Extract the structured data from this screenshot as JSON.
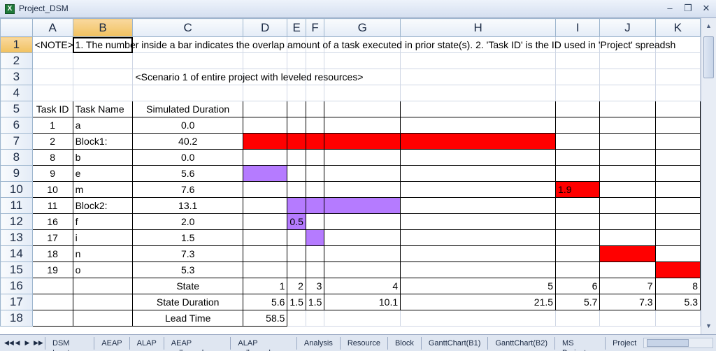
{
  "window": {
    "title": "Project_DSM",
    "app_icon": "excel-icon",
    "controls": [
      "minimize",
      "restore",
      "close"
    ]
  },
  "columns": [
    "A",
    "B",
    "C",
    "D",
    "E",
    "F",
    "G",
    "H",
    "I",
    "J",
    "K"
  ],
  "rows": [
    "1",
    "2",
    "3",
    "4",
    "5",
    "6",
    "7",
    "8",
    "9",
    "10",
    "11",
    "12",
    "13",
    "14",
    "15",
    "16",
    "17",
    "18"
  ],
  "note": {
    "a1": "<NOTE>",
    "b1": "1. The number inside a bar indicates the overlap amount of a task executed in prior state(s).   2. 'Task ID' is the ID used in 'Project' spreadsh"
  },
  "scenario_title": "<Scenario 1 of entire project with leveled resources>",
  "headers": {
    "task_id": "Task ID",
    "task_name": "Task Name",
    "simulated_duration": "Simulated Duration"
  },
  "tasks": [
    {
      "id": "1",
      "name": "a",
      "duration": "0.0"
    },
    {
      "id": "2",
      "name": "Block1:",
      "duration": "40.2"
    },
    {
      "id": "8",
      "name": "b",
      "duration": "0.0"
    },
    {
      "id": "9",
      "name": "e",
      "duration": "5.6"
    },
    {
      "id": "10",
      "name": "m",
      "duration": "7.6"
    },
    {
      "id": "11",
      "name": "Block2:",
      "duration": "13.1"
    },
    {
      "id": "16",
      "name": "f",
      "duration": "2.0"
    },
    {
      "id": "17",
      "name": "i",
      "duration": "1.5"
    },
    {
      "id": "18",
      "name": "n",
      "duration": "7.3"
    },
    {
      "id": "19",
      "name": "o",
      "duration": "5.3"
    }
  ],
  "bar_labels": {
    "m_overlap": "1.9",
    "f_overlap": "0.5"
  },
  "state_row": {
    "label": "State",
    "values": [
      "1",
      "2",
      "3",
      "4",
      "5",
      "6",
      "7",
      "8"
    ]
  },
  "state_duration_row": {
    "label": "State Duration",
    "values": [
      "5.6",
      "1.5",
      "1.5",
      "10.1",
      "21.5",
      "5.7",
      "7.3",
      "5.3"
    ]
  },
  "lead_time_row": {
    "label": "Lead Time",
    "value": "58.5"
  },
  "colors": {
    "critical_bar": "#ff0000",
    "noncritical_bar": "#b57bff",
    "selected_header": "#f1c15f"
  },
  "sheet_tabs": [
    "DSM Input",
    "AEAP",
    "ALAP",
    "AEAP collapsed",
    "ALAP collapsed",
    "Analysis",
    "Resource",
    "Block",
    "GanttChart(B1)",
    "GanttChart(B2)",
    "MS Project",
    "Project"
  ]
}
